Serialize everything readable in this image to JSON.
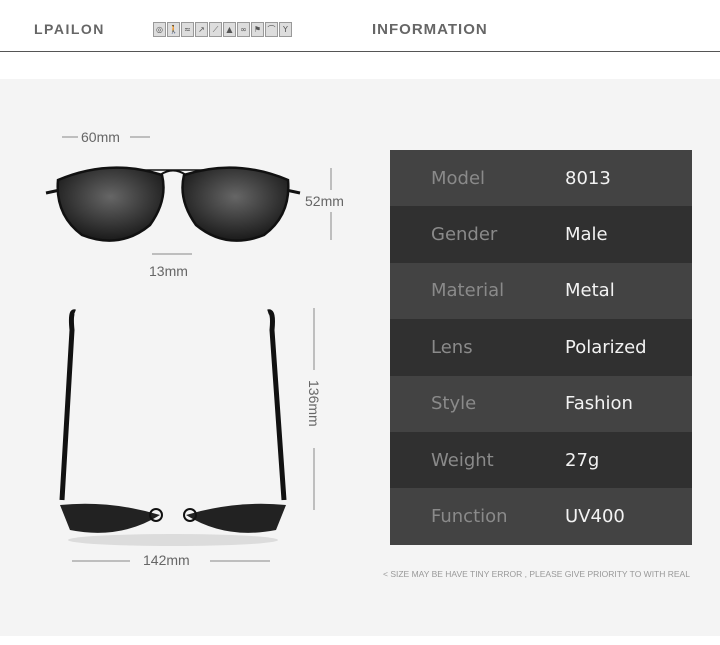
{
  "header": {
    "brand": "LPAILON",
    "section_title": "INFORMATION",
    "activity_icons": [
      "steering-wheel",
      "hiking",
      "swimming",
      "running",
      "skiing",
      "climbing",
      "cycling",
      "golf",
      "fishing",
      "yoga"
    ]
  },
  "dimensions": {
    "lens_width": "60mm",
    "lens_height": "52mm",
    "bridge": "13mm",
    "temple_length": "136mm",
    "frame_width": "142mm"
  },
  "specs": [
    {
      "label": "Model",
      "value": "8013"
    },
    {
      "label": "Gender",
      "value": "Male"
    },
    {
      "label": "Material",
      "value": "Metal"
    },
    {
      "label": "Lens",
      "value": "Polarized"
    },
    {
      "label": "Style",
      "value": "Fashion"
    },
    {
      "label": "Weight",
      "value": "27g"
    },
    {
      "label": "Function",
      "value": "UV400"
    }
  ],
  "note": "<  SIZE MAY BE HAVE TINY ERROR , PLEASE GIVE PRIORITY TO WITH REAL"
}
